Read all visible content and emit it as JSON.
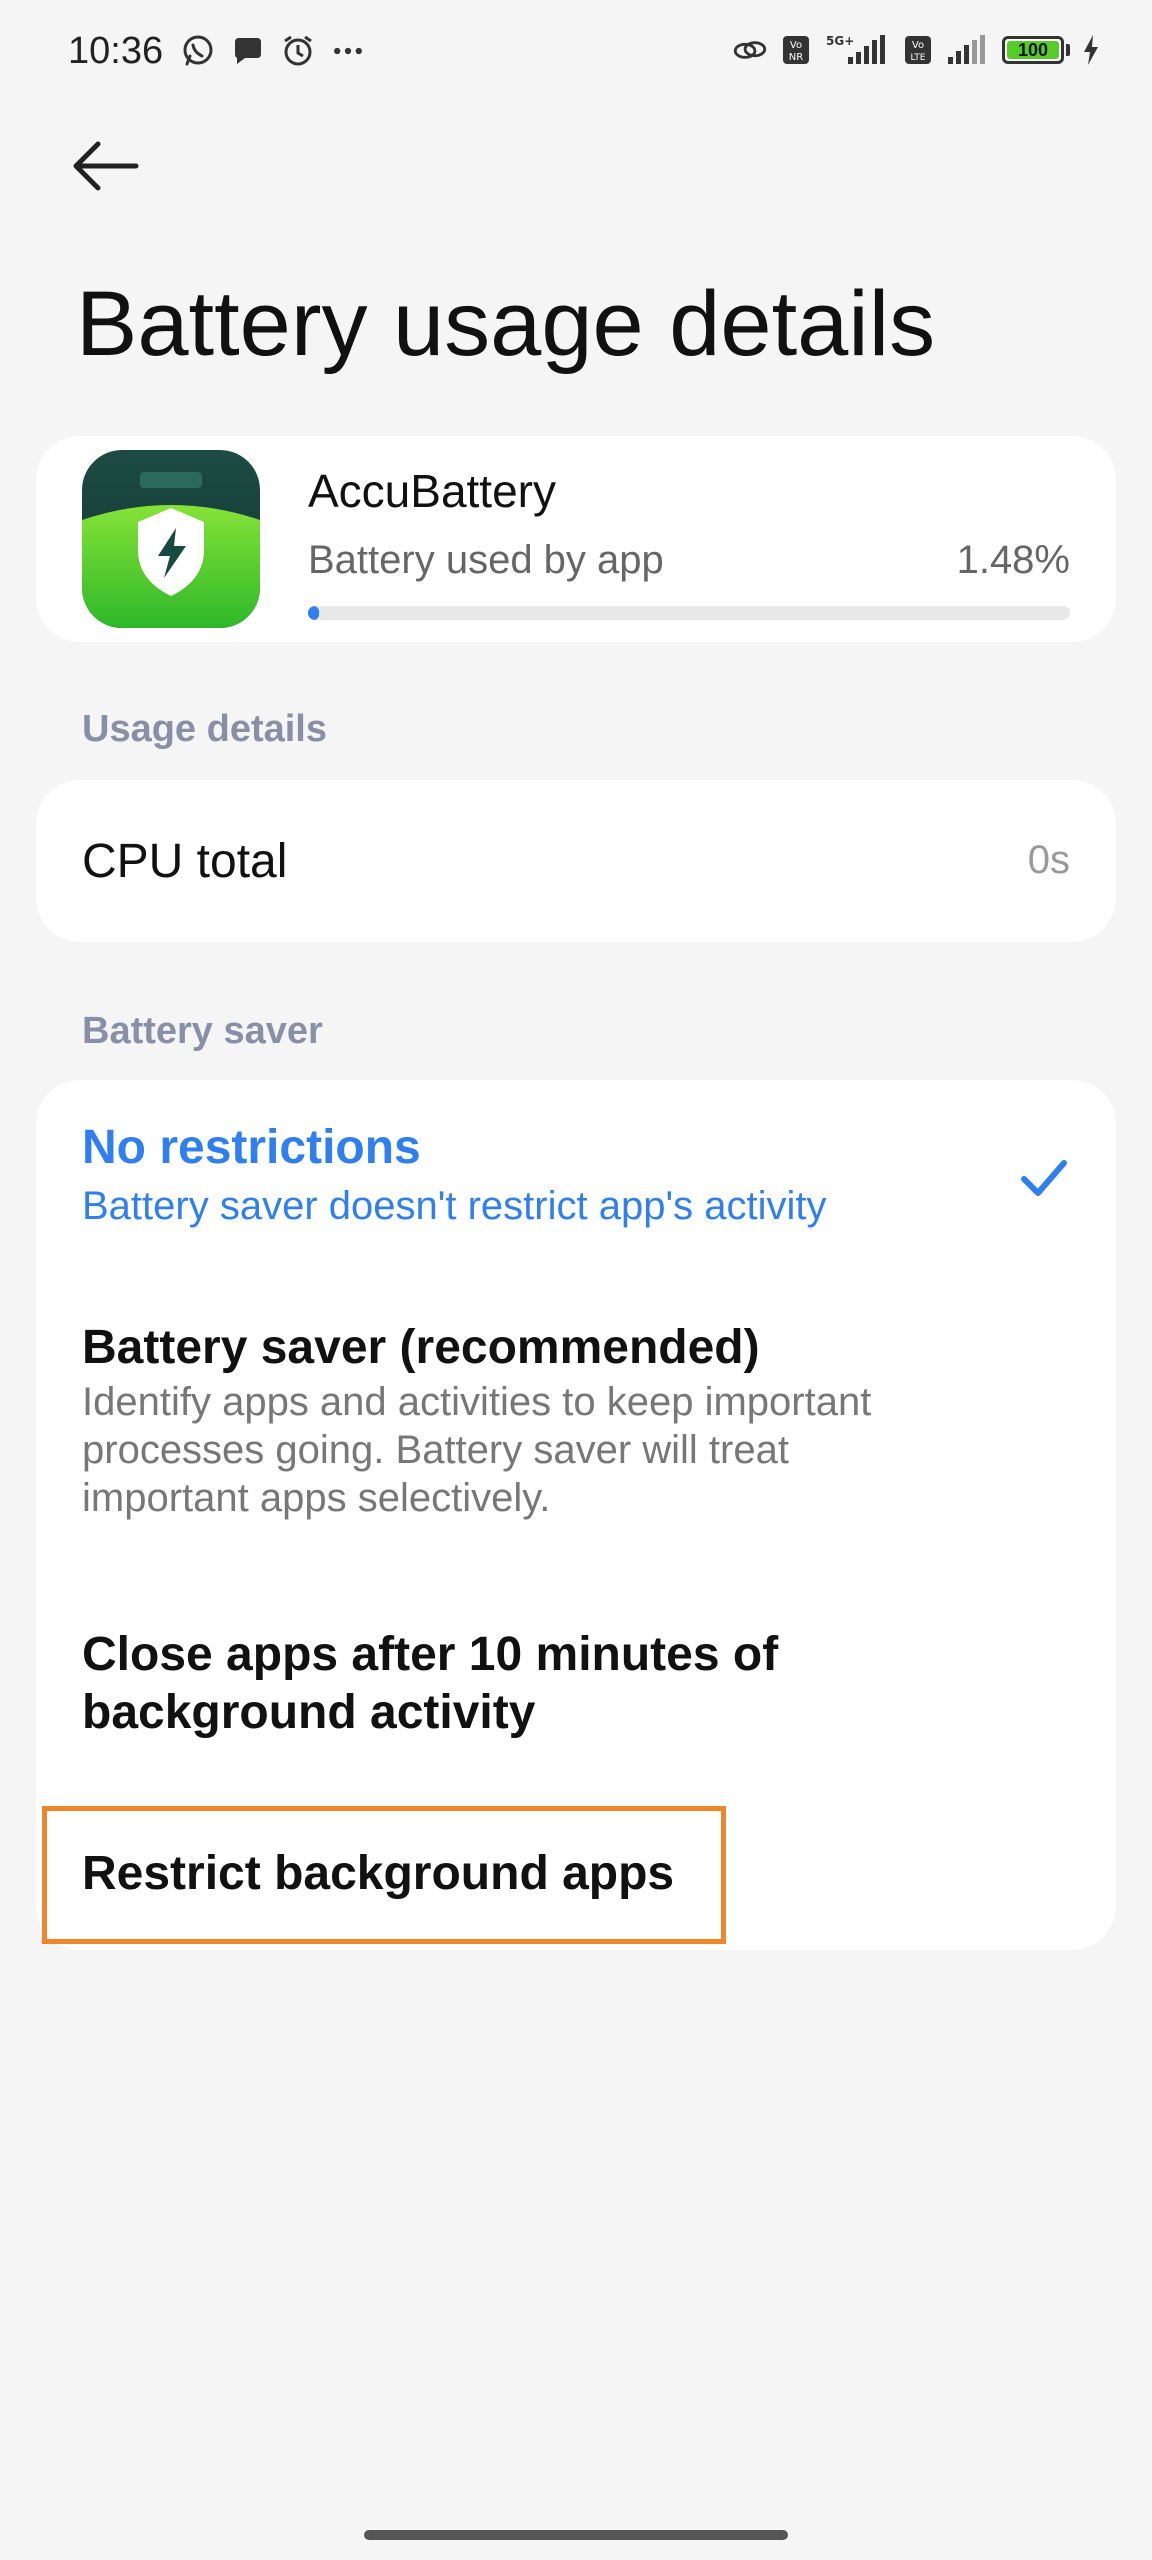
{
  "status_bar": {
    "time": "10:36",
    "battery_level": "100",
    "left_icons": [
      "whatsapp-icon",
      "chat-bubble-icon",
      "alarm-icon",
      "more-dots-icon"
    ],
    "right_icons": [
      "link-icon",
      "vonr-icon",
      "5g-signal-icon",
      "volte-icon",
      "signal-icon",
      "battery-icon",
      "charging-bolt-icon"
    ]
  },
  "header": {
    "back_icon": "arrow-left-icon",
    "title": "Battery usage details"
  },
  "app": {
    "name": "AccuBattery",
    "usage_label": "Battery used by app",
    "usage_value": "1.48%",
    "usage_fraction": 0.0148,
    "accent": "#2f7ff0"
  },
  "usage_details": {
    "section_label": "Usage details",
    "cpu_label": "CPU total",
    "cpu_value": "0s"
  },
  "battery_saver": {
    "section_label": "Battery saver",
    "options": [
      {
        "title": "No restrictions",
        "description": "Battery saver doesn't restrict app's activity",
        "selected": true
      },
      {
        "title": "Battery saver (recommended)",
        "description": "Identify apps and activities to keep important processes going. Battery saver will treat important apps selectively.",
        "selected": false
      },
      {
        "title": "Close apps after 10 minutes of background activity",
        "selected": false
      },
      {
        "title": "Restrict background apps",
        "selected": false
      }
    ]
  },
  "colors": {
    "background": "#f5f5f5",
    "selected_blue": "#2f7ff0",
    "section_label": "#8a8fa8",
    "highlight_orange": "#f0862c"
  }
}
